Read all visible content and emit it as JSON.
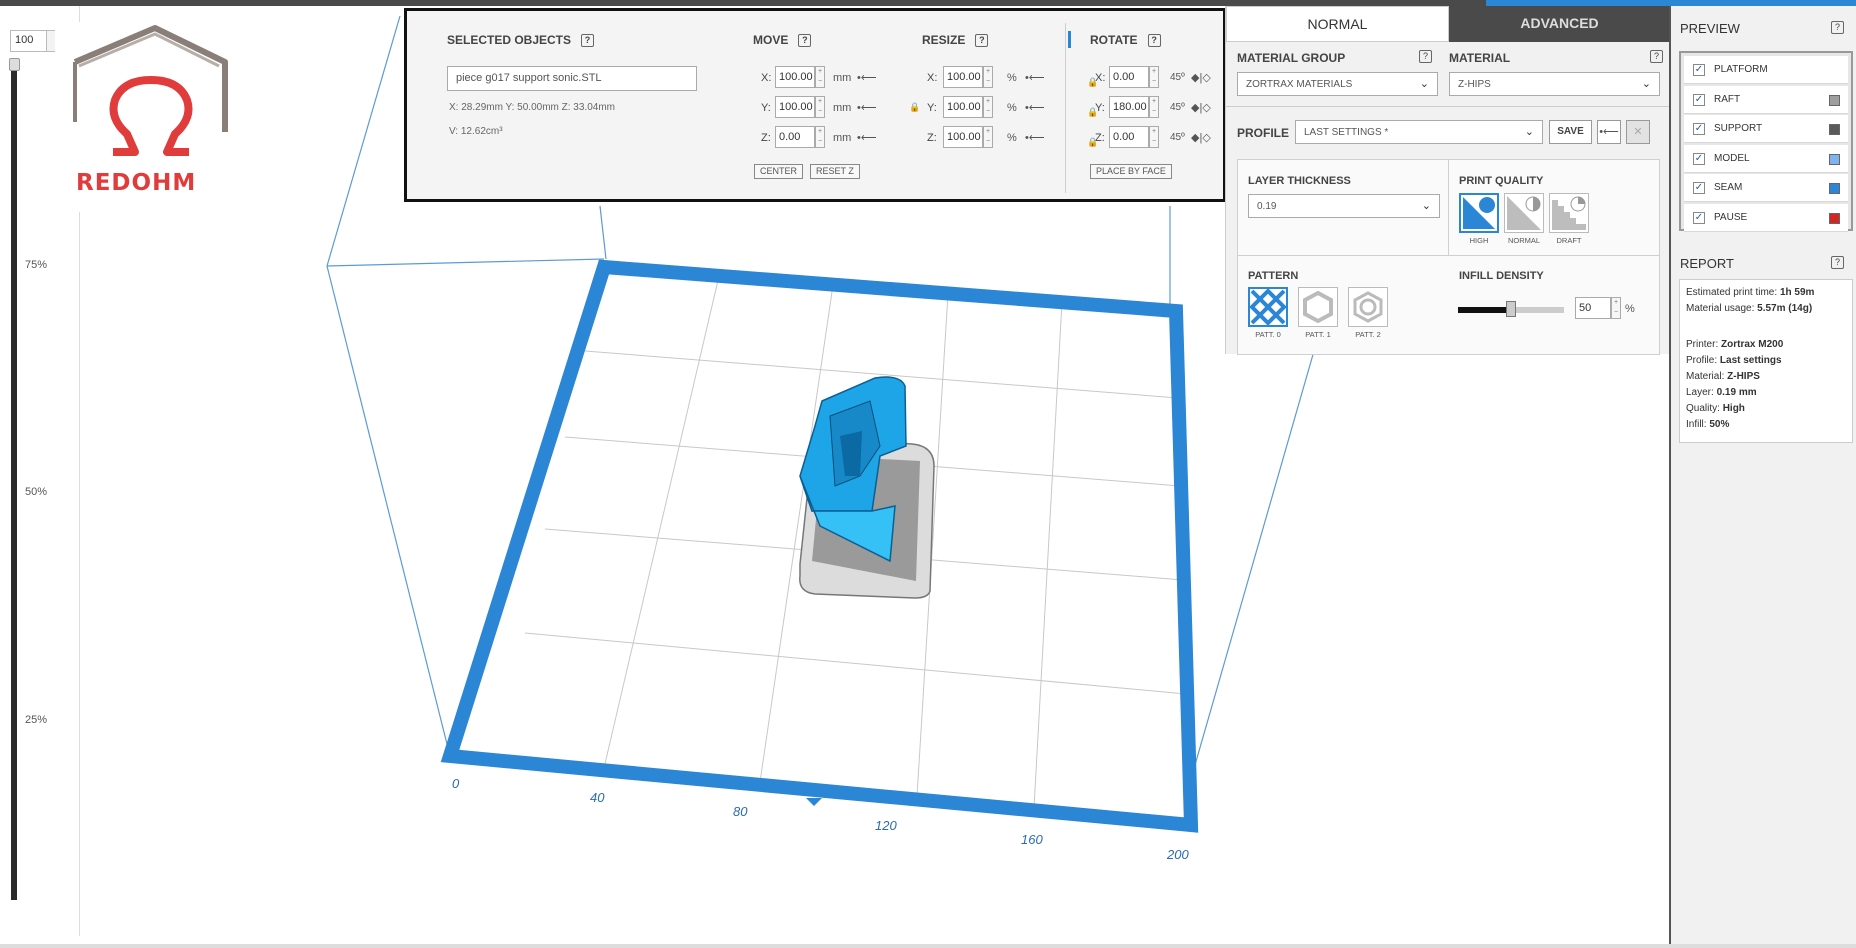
{
  "toolbar": {
    "zoom_value": "100"
  },
  "slider": {
    "labels": [
      "75%",
      "50%",
      "25%"
    ]
  },
  "logo": {
    "text": "REDOHM"
  },
  "selected_objects": {
    "title": "SELECTED OBJECTS",
    "help": "?",
    "filename": "piece g017 support sonic.STL",
    "dims": "X: 28.29mm   Y: 50.00mm   Z: 33.04mm",
    "volume": "V: 12.62cm³"
  },
  "move": {
    "title": "MOVE",
    "help": "?",
    "x": "100.00",
    "y": "100.00",
    "z": "0.00",
    "unit": "mm",
    "center_label": "CENTER",
    "reset_z_label": "RESET Z"
  },
  "resize": {
    "title": "RESIZE",
    "help": "?",
    "x": "100.00",
    "y": "100.00",
    "z": "100.00",
    "unit": "%"
  },
  "rotate": {
    "title": "ROTATE",
    "help": "?",
    "x": "0.00",
    "y": "180.00",
    "z": "0.00",
    "step": "45º",
    "place_by_face_label": "PLACE BY FACE"
  },
  "axis_labels": {
    "x": "X:",
    "y": "Y:",
    "z": "Z:"
  },
  "tabs": {
    "normal": "NORMAL",
    "advanced": "ADVANCED"
  },
  "settings": {
    "material_group_label": "MATERIAL GROUP",
    "material_group_value": "ZORTRAX MATERIALS",
    "material_label": "MATERIAL",
    "material_value": "Z-HIPS",
    "profile_label": "PROFILE",
    "profile_value": "LAST SETTINGS *",
    "save_label": "SAVE",
    "layer_thickness_label": "LAYER THICKNESS",
    "layer_thickness_value": "0.19",
    "print_quality_label": "PRINT QUALITY",
    "quality_options": [
      "HIGH",
      "NORMAL",
      "DRAFT"
    ],
    "quality_selected": "HIGH",
    "pattern_label": "PATTERN",
    "patterns": [
      "PATT. 0",
      "PATT. 1",
      "PATT. 2"
    ],
    "pattern_selected": "PATT. 0",
    "infill_density_label": "INFILL DENSITY",
    "infill_value": "50",
    "infill_unit": "%",
    "infill_fraction": 0.5,
    "help": "?"
  },
  "preview": {
    "title": "PREVIEW",
    "help": "?",
    "items": [
      {
        "label": "PLATFORM",
        "checked": true,
        "color": ""
      },
      {
        "label": "RAFT",
        "checked": true,
        "color": "#9e9e9e"
      },
      {
        "label": "SUPPORT",
        "checked": true,
        "color": "#5a5a5a"
      },
      {
        "label": "MODEL",
        "checked": true,
        "color": "#7fb3ee"
      },
      {
        "label": "SEAM",
        "checked": true,
        "color": "#2b86d6"
      },
      {
        "label": "PAUSE",
        "checked": true,
        "color": "#d42424"
      }
    ]
  },
  "report": {
    "title": "REPORT",
    "help": "?",
    "lines": [
      {
        "key": "Estimated print time:",
        "value": "1h 59m"
      },
      {
        "key": "Material usage:",
        "value": "5.57m (14g)"
      },
      {
        "key": "Printer:",
        "value": "Zortrax M200"
      },
      {
        "key": "Profile:",
        "value": "Last settings"
      },
      {
        "key": "Material:",
        "value": "Z-HIPS"
      },
      {
        "key": "Layer:",
        "value": "0.19 mm"
      },
      {
        "key": "Quality:",
        "value": "High"
      },
      {
        "key": "Infill:",
        "value": "50%"
      }
    ]
  },
  "platform": {
    "axis_ticks": [
      "0",
      "40",
      "80",
      "120",
      "160",
      "200"
    ]
  },
  "colors": {
    "accent": "#2b86d6",
    "model": "#1ea5e8",
    "brand_red": "#e03c3c"
  }
}
